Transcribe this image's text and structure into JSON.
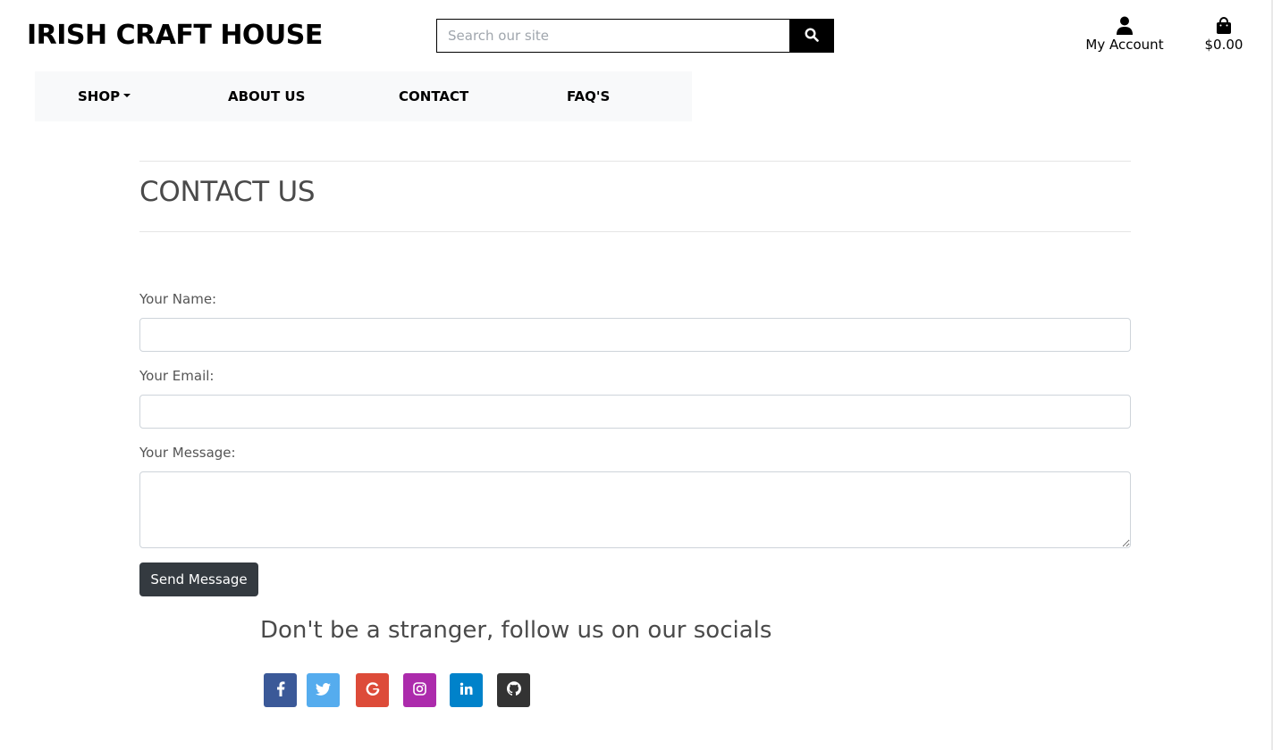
{
  "header": {
    "brand": "IRISH CRAFT HOUSE",
    "search_placeholder": "Search our site",
    "account_label": "My Account",
    "cart_total": "$0.00"
  },
  "nav": {
    "items": [
      {
        "label": "SHOP",
        "has_dropdown": true
      },
      {
        "label": "ABOUT US"
      },
      {
        "label": "CONTACT"
      },
      {
        "label": "FAQ'S"
      }
    ]
  },
  "page": {
    "title": "CONTACT US"
  },
  "form": {
    "name_label": "Your Name:",
    "email_label": "Your Email:",
    "message_label": "Your Message:",
    "name_value": "",
    "email_value": "",
    "message_value": "",
    "submit_label": "Send Message"
  },
  "socials": {
    "heading": "Don't be a stranger, follow us on our socials",
    "links": [
      {
        "icon": "facebook-icon",
        "color": "#3b5998"
      },
      {
        "icon": "twitter-icon",
        "color": "#55acee"
      },
      {
        "icon": "google-icon",
        "color": "#dd4b39"
      },
      {
        "icon": "instagram-icon",
        "color": "#ac2bac"
      },
      {
        "icon": "linkedin-icon",
        "color": "#0082ca"
      },
      {
        "icon": "github-icon",
        "color": "#333333"
      }
    ]
  },
  "colors": {
    "dark_button": "#343a40",
    "nav_background": "#f8f9fa"
  }
}
